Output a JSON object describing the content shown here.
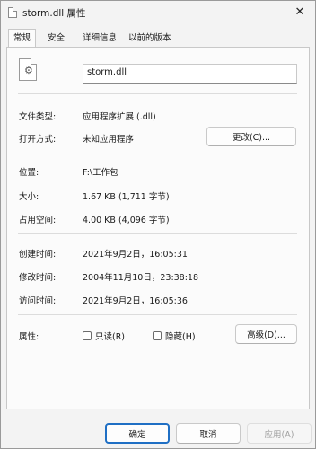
{
  "window": {
    "title": "storm.dll 属性",
    "close_glyph": "✕"
  },
  "tabs": [
    {
      "label": "常规",
      "active": true
    },
    {
      "label": "安全",
      "active": false
    },
    {
      "label": "详细信息",
      "active": false
    },
    {
      "label": "以前的版本",
      "active": false
    }
  ],
  "general": {
    "file_name": "storm.dll",
    "type_label": "文件类型:",
    "type_value": "应用程序扩展 (.dll)",
    "opens_with_label": "打开方式:",
    "opens_with_value": "未知应用程序",
    "change_button": "更改(C)...",
    "location_label": "位置:",
    "location_value": "F:\\工作包",
    "size_label": "大小:",
    "size_value": "1.67 KB (1,711 字节)",
    "size_on_disk_label": "占用空间:",
    "size_on_disk_value": "4.00 KB (4,096 字节)",
    "created_label": "创建时间:",
    "created_value": "2021年9月2日，16:05:31",
    "modified_label": "修改时间:",
    "modified_value": "2004年11月10日，23:38:18",
    "accessed_label": "访问时间:",
    "accessed_value": "2021年9月2日，16:05:36",
    "attributes_label": "属性:",
    "readonly_label": "只读(R)",
    "hidden_label": "隐藏(H)",
    "advanced_button": "高级(D)..."
  },
  "footer": {
    "ok": "确定",
    "cancel": "取消",
    "apply": "应用(A)"
  }
}
